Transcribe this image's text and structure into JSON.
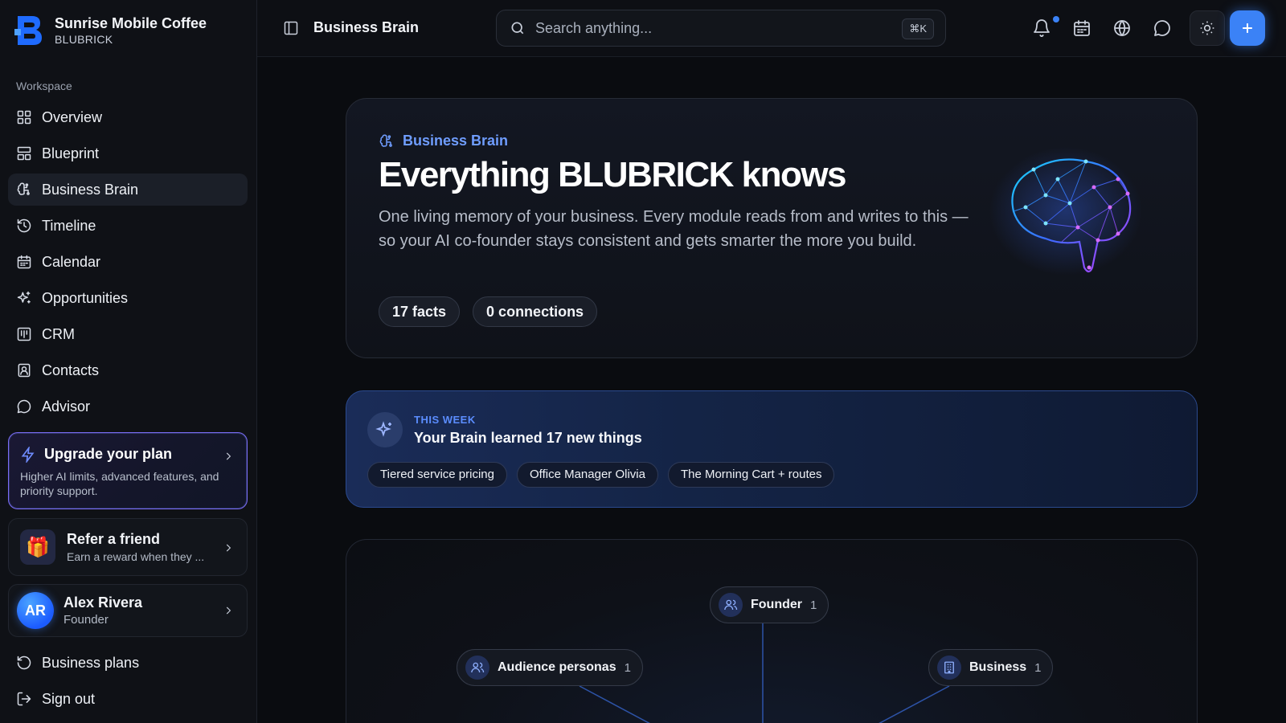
{
  "brand": {
    "name": "Sunrise Mobile Coffee",
    "subtitle": "BLUBRICK"
  },
  "sidebar": {
    "section_label": "Workspace",
    "items": [
      {
        "label": "Overview",
        "icon": "grid-icon"
      },
      {
        "label": "Blueprint",
        "icon": "layout-icon"
      },
      {
        "label": "Business Brain",
        "icon": "brain-icon",
        "active": true
      },
      {
        "label": "Timeline",
        "icon": "history-icon"
      },
      {
        "label": "Calendar",
        "icon": "calendar-icon"
      },
      {
        "label": "Opportunities",
        "icon": "sparkles-icon"
      },
      {
        "label": "CRM",
        "icon": "kanban-icon"
      },
      {
        "label": "Contacts",
        "icon": "contact-icon"
      },
      {
        "label": "Advisor",
        "icon": "chat-icon"
      }
    ],
    "upgrade": {
      "title": "Upgrade your plan",
      "text": "Higher AI limits, advanced features, and priority support."
    },
    "refer": {
      "title": "Refer a friend",
      "text": "Earn a reward when they ..."
    },
    "user": {
      "initials": "AR",
      "name": "Alex Rivera",
      "role": "Founder"
    },
    "bottom_items": [
      {
        "label": "Business plans",
        "icon": "history-icon"
      },
      {
        "label": "Sign out",
        "icon": "logout-icon"
      }
    ]
  },
  "topbar": {
    "title": "Business Brain",
    "search_placeholder": "Search anything...",
    "search_shortcut": "⌘K"
  },
  "hero": {
    "tag": "Business Brain",
    "title": "Everything BLUBRICK knows",
    "description": "One living memory of your business. Every module reads from and writes to this — so your AI co-founder stays consistent and gets smarter the more you build.",
    "chips": [
      "17 facts",
      "0 connections"
    ]
  },
  "this_week": {
    "label": "THIS WEEK",
    "title": "Your Brain learned 17 new things",
    "items": [
      "Tiered service pricing",
      "Office Manager Olivia",
      "The Morning Cart + routes"
    ]
  },
  "graph": {
    "nodes": [
      {
        "label": "Founder",
        "count": "1",
        "icon": "users-icon"
      },
      {
        "label": "Audience personas",
        "count": "1",
        "icon": "users-icon"
      },
      {
        "label": "Business",
        "count": "1",
        "icon": "building-icon"
      }
    ]
  },
  "colors": {
    "accent": "#3b82f6",
    "upgrade_border": "#7b6cf6",
    "week_label": "#5b8dff"
  }
}
